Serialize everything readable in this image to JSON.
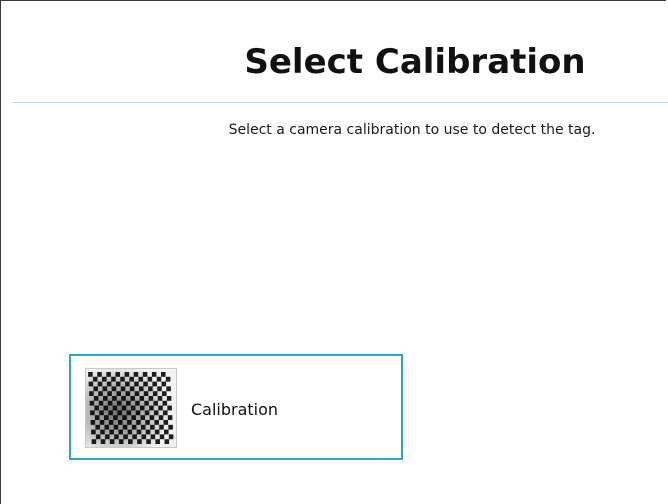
{
  "header": {
    "title": "Select Calibration"
  },
  "main": {
    "instruction": "Select a camera calibration to use to detect the tag.",
    "calibrations": [
      {
        "label": "Calibration",
        "thumbnail_icon": "checkerboard-icon"
      }
    ]
  },
  "colors": {
    "divider": "#bfdde5",
    "card_border": "#2ea6c4",
    "title_text": "#111111"
  }
}
